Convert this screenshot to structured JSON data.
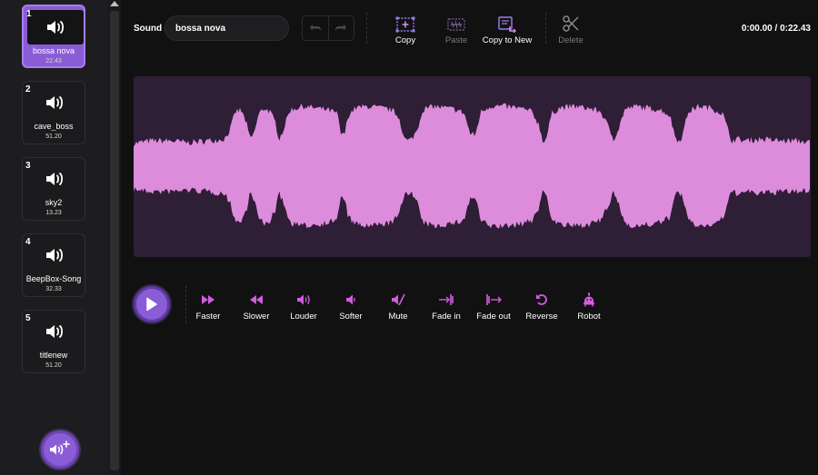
{
  "sounds": [
    {
      "index": "1",
      "name": "bossa nova",
      "duration": "22.43",
      "selected": true
    },
    {
      "index": "2",
      "name": "cave_boss",
      "duration": "51.20",
      "selected": false
    },
    {
      "index": "3",
      "name": "sky2",
      "duration": "13.23",
      "selected": false
    },
    {
      "index": "4",
      "name": "BeepBox-Song",
      "duration": "32.33",
      "selected": false
    },
    {
      "index": "5",
      "name": "titlenew",
      "duration": "51.20",
      "selected": false
    }
  ],
  "editor": {
    "sound_label": "Sound",
    "sound_name": "bossa nova",
    "time_readout": "0:00.00 / 0:22.43"
  },
  "tools": {
    "copy": "Copy",
    "paste": "Paste",
    "copy_to_new": "Copy to New",
    "delete": "Delete"
  },
  "effects": {
    "faster": "Faster",
    "slower": "Slower",
    "louder": "Louder",
    "softer": "Softer",
    "mute": "Mute",
    "fade_in": "Fade in",
    "fade_out": "Fade out",
    "reverse": "Reverse",
    "robot": "Robot"
  },
  "colors": {
    "accent": "#8a5cd6",
    "effect_icon": "#d35be0",
    "waveform_fill": "#dd8cdc",
    "waveform_bg": "#2e1e36"
  },
  "icons": {
    "tile": "speaker-icon",
    "add_sound": "add-sound-icon",
    "play": "play-icon"
  }
}
